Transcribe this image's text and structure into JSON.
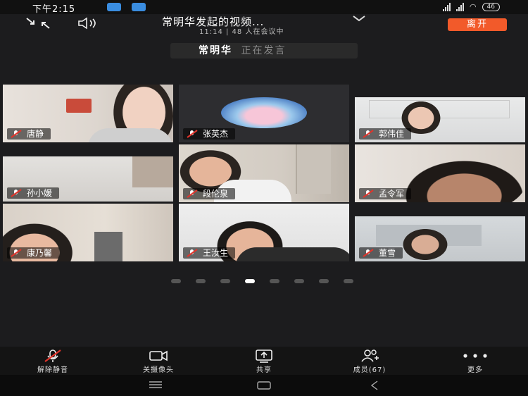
{
  "status": {
    "time": "下午2:15",
    "battery": "46"
  },
  "meeting": {
    "title": "常明华发起的视频...",
    "subtitle": "11:14  |  48 人在会议中",
    "leave_label": "离开"
  },
  "speaker": {
    "name": "常明华",
    "status": "正在发言"
  },
  "tiles": [
    {
      "name": "唐静"
    },
    {
      "name": "张英杰"
    },
    {
      "name": "郭伟佳"
    },
    {
      "name": "孙小媛"
    },
    {
      "name": "段伦泉"
    },
    {
      "name": "孟令军"
    },
    {
      "name": "康乃馨"
    },
    {
      "name": "王汝生"
    },
    {
      "name": "董雪"
    }
  ],
  "pager": {
    "count": 8,
    "active_index": 3
  },
  "toolbar": {
    "unmute": "解除静音",
    "camera_off": "关摄像头",
    "share": "共享",
    "members": "成员(67)",
    "more": "更多"
  },
  "colors": {
    "accent": "#f25a2a",
    "background": "#1c1c1e",
    "mic_muted": "#e2342b"
  }
}
